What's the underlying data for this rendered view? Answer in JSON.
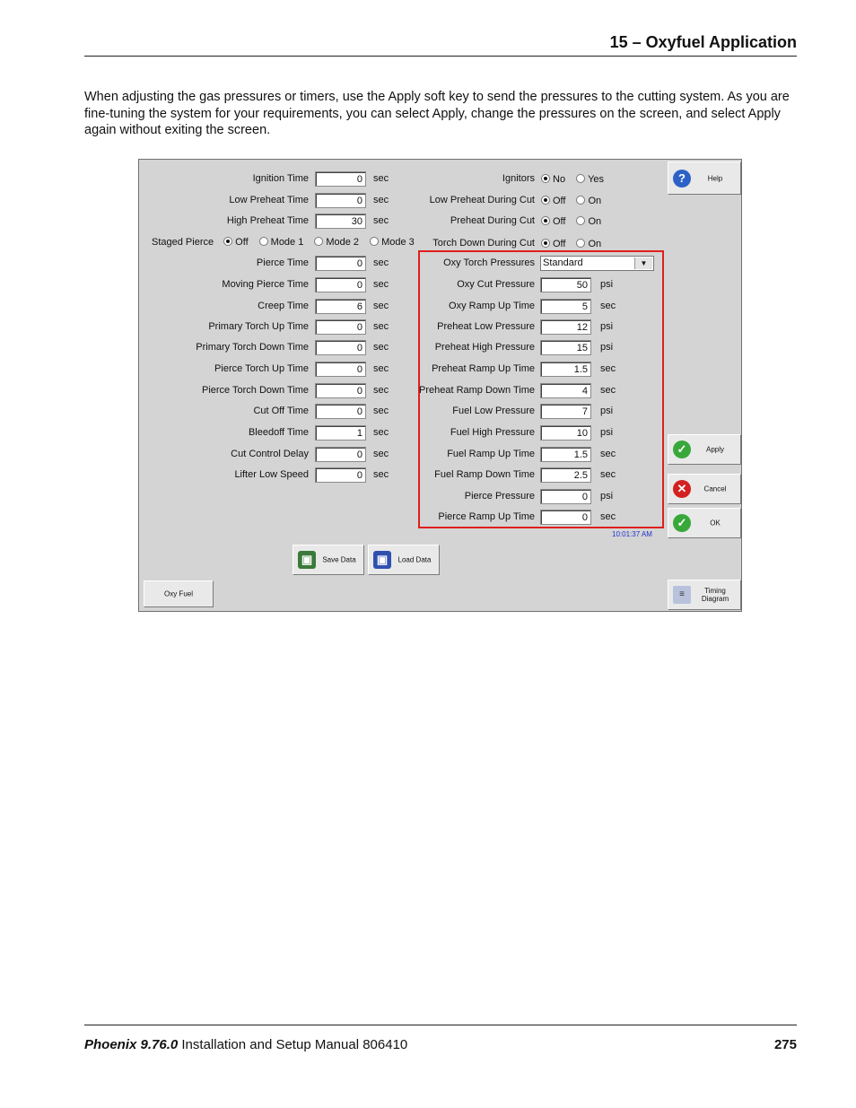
{
  "header": {
    "chapter": "15  –  Oxyfuel Application"
  },
  "intro": "When adjusting the gas pressures or timers, use the Apply soft key to send the pressures to the cutting system. As you are fine-tuning the system for your requirements, you can select Apply, change the pressures on the screen, and select Apply again without exiting the screen.",
  "screen": {
    "left_fields": [
      {
        "label": "Ignition Time",
        "value": "0",
        "unit": "sec"
      },
      {
        "label": "Low Preheat Time",
        "value": "0",
        "unit": "sec"
      },
      {
        "label": "High Preheat Time",
        "value": "30",
        "unit": "sec"
      },
      {
        "label": "Pierce Time",
        "value": "0",
        "unit": "sec"
      },
      {
        "label": "Moving Pierce Time",
        "value": "0",
        "unit": "sec"
      },
      {
        "label": "Creep Time",
        "value": "6",
        "unit": "sec"
      },
      {
        "label": "Primary Torch Up Time",
        "value": "0",
        "unit": "sec"
      },
      {
        "label": "Primary Torch Down Time",
        "value": "0",
        "unit": "sec"
      },
      {
        "label": "Pierce Torch Up Time",
        "value": "0",
        "unit": "sec"
      },
      {
        "label": "Pierce Torch Down Time",
        "value": "0",
        "unit": "sec"
      },
      {
        "label": "Cut Off Time",
        "value": "0",
        "unit": "sec"
      },
      {
        "label": "Bleedoff Time",
        "value": "1",
        "unit": "sec"
      },
      {
        "label": "Cut Control Delay",
        "value": "0",
        "unit": "sec"
      },
      {
        "label": "Lifter Low Speed",
        "value": "0",
        "unit": "sec"
      }
    ],
    "staged_pierce": {
      "label": "Staged Pierce",
      "options": [
        "Off",
        "Mode 1",
        "Mode 2",
        "Mode 3"
      ],
      "selected": "Off"
    },
    "radio_groups": [
      {
        "label": "Ignitors",
        "options": [
          "No",
          "Yes"
        ],
        "selected": "No"
      },
      {
        "label": "Low Preheat During Cut",
        "options": [
          "Off",
          "On"
        ],
        "selected": "Off"
      },
      {
        "label": "Preheat During Cut",
        "options": [
          "Off",
          "On"
        ],
        "selected": "Off"
      },
      {
        "label": "Torch Down During Cut",
        "options": [
          "Off",
          "On"
        ],
        "selected": "Off"
      }
    ],
    "oxy_torch_pressures": {
      "label": "Oxy Torch Pressures",
      "value": "Standard"
    },
    "right_fields": [
      {
        "label": "Oxy Cut Pressure",
        "value": "50",
        "unit": "psi"
      },
      {
        "label": "Oxy Ramp Up Time",
        "value": "5",
        "unit": "sec"
      },
      {
        "label": "Preheat Low Pressure",
        "value": "12",
        "unit": "psi"
      },
      {
        "label": "Preheat High Pressure",
        "value": "15",
        "unit": "psi"
      },
      {
        "label": "Preheat Ramp Up Time",
        "value": "1.5",
        "unit": "sec"
      },
      {
        "label": "Preheat Ramp Down Time",
        "value": "4",
        "unit": "sec"
      },
      {
        "label": "Fuel Low Pressure",
        "value": "7",
        "unit": "psi"
      },
      {
        "label": "Fuel High Pressure",
        "value": "10",
        "unit": "psi"
      },
      {
        "label": "Fuel Ramp Up Time",
        "value": "1.5",
        "unit": "sec"
      },
      {
        "label": "Fuel Ramp Down Time",
        "value": "2.5",
        "unit": "sec"
      },
      {
        "label": "Pierce Pressure",
        "value": "0",
        "unit": "psi"
      },
      {
        "label": "Pierce Ramp Up Time",
        "value": "0",
        "unit": "sec"
      }
    ],
    "clock": "10:01:37 AM",
    "buttons": {
      "help": "Help",
      "apply": "Apply",
      "cancel": "Cancel",
      "ok": "OK",
      "save": "Save Data",
      "load": "Load Data",
      "oxy_fuel": "Oxy Fuel",
      "timing": "Timing Diagram"
    }
  },
  "footer": {
    "product": "Phoenix 9.76.0",
    "manual": "Installation and Setup Manual  806410",
    "page": "275"
  },
  "colors": {
    "highlight_box": "#e01e1e",
    "clock": "#2233cc"
  }
}
